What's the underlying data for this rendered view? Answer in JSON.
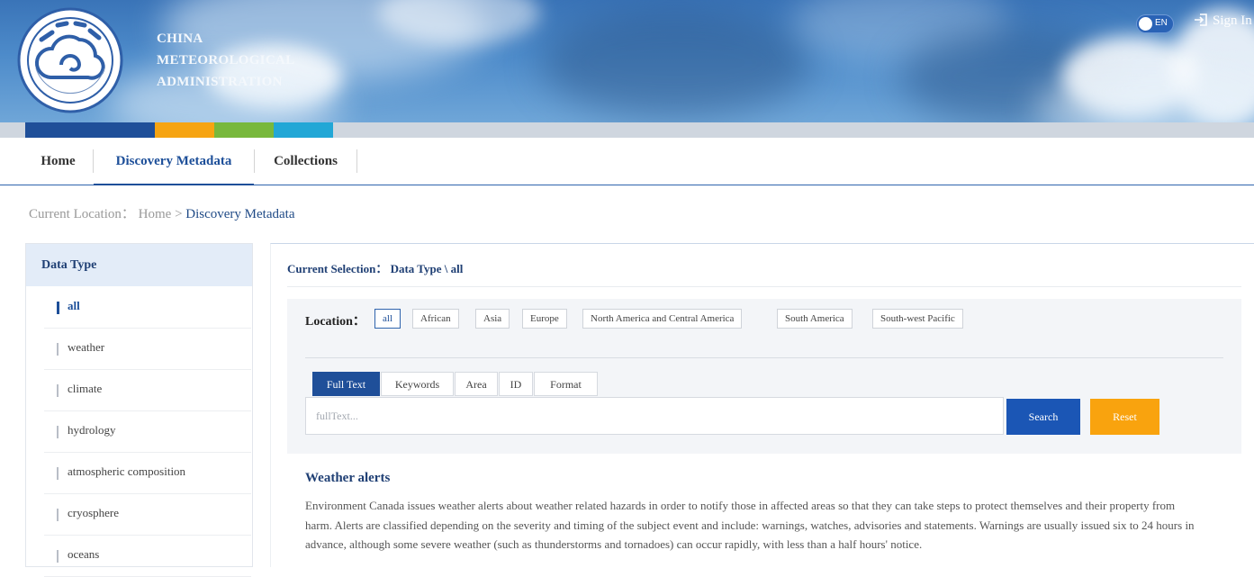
{
  "header": {
    "org_name_lines": [
      "CHINA",
      "METEOROLOGICAL",
      "ADMINISTRATION"
    ],
    "lang_toggle_label": "EN",
    "signin_label": "Sign In",
    "colorbar_colors": [
      "#1f4f99",
      "#f6a412",
      "#78b83c",
      "#22a7d6"
    ]
  },
  "nav": {
    "items": [
      {
        "label": "Home"
      },
      {
        "label": "Discovery Metadata"
      },
      {
        "label": "Collections"
      }
    ],
    "active": "Discovery Metadata"
  },
  "breadcrumb": {
    "prefix": "Current Location：",
    "home": "Home",
    "separator": ">",
    "current": "Discovery Metadata"
  },
  "sidebar": {
    "title": "Data Type",
    "items": [
      {
        "label": "all"
      },
      {
        "label": "weather"
      },
      {
        "label": "climate"
      },
      {
        "label": "hydrology"
      },
      {
        "label": "atmospheric composition"
      },
      {
        "label": "cryosphere"
      },
      {
        "label": "oceans"
      }
    ],
    "active": "all"
  },
  "selection": {
    "label": "Current Selection：",
    "value": "Data Type \\ all"
  },
  "location": {
    "label": "Location：",
    "options": [
      "all",
      "African",
      "Asia",
      "Europe",
      "North America and Central America",
      "South America",
      "South-west Pacific"
    ],
    "selected": "all"
  },
  "search": {
    "tabs": [
      "Full Text",
      "Keywords",
      "Area",
      "ID",
      "Format"
    ],
    "active_tab": "Full Text",
    "placeholder": "fullText...",
    "value": "",
    "search_label": "Search",
    "reset_label": "Reset"
  },
  "result": {
    "title": "Weather alerts",
    "description": "Environment Canada issues weather alerts about weather related hazards in order to notify those in affected areas so that they can take steps to protect themselves and their property from harm. Alerts are classified depending on the severity and timing of the subject event and include: warnings, watches, advisories and statements. Warnings are usually issued six to 24 hours in advance, although some severe weather (such as thunderstorms and tornadoes) can occur rapidly, with less than a half hours' notice."
  }
}
